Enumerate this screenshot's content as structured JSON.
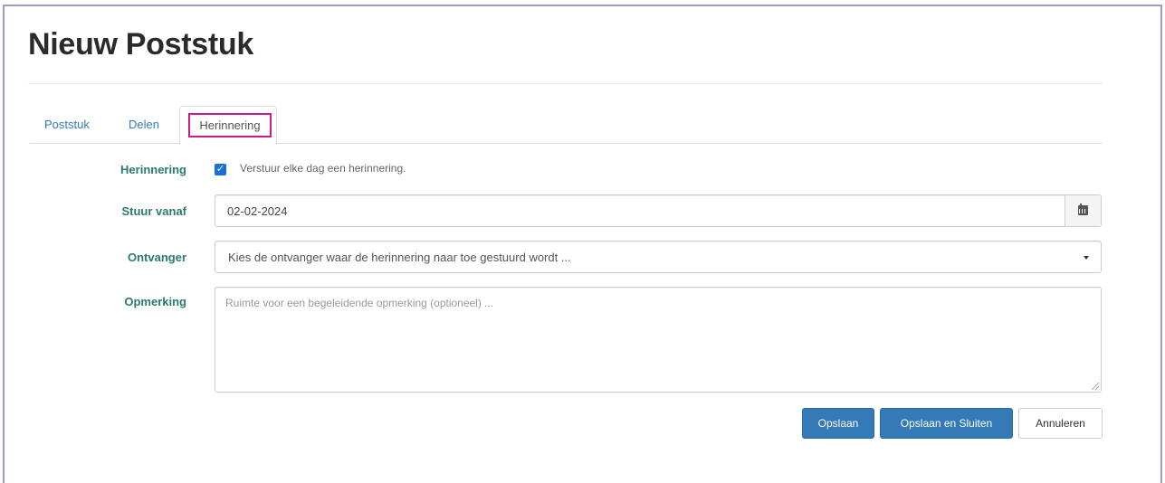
{
  "page": {
    "title": "Nieuw Poststuk"
  },
  "tabs": [
    {
      "label": "Poststuk"
    },
    {
      "label": "Delen"
    },
    {
      "label": "Herinnering",
      "active": true
    }
  ],
  "form": {
    "reminder": {
      "label": "Herinnering",
      "checkbox_checked": true,
      "checkbox_label": "Verstuur elke dag een herinnering."
    },
    "send_from": {
      "label": "Stuur vanaf",
      "value": "02-02-2024",
      "icon": "calendar-icon"
    },
    "recipient": {
      "label": "Ontvanger",
      "placeholder": "Kies de ontvanger waar de herinnering naar toe gestuurd wordt ..."
    },
    "remark": {
      "label": "Opmerking",
      "placeholder": "Ruimte voor een begeleidende opmerking (optioneel) ..."
    }
  },
  "buttons": {
    "save": "Opslaan",
    "save_close": "Opslaan en Sluiten",
    "cancel": "Annuleren"
  },
  "colors": {
    "accent": "#337ab7",
    "label": "#2a7a70",
    "highlight": "#cc1a8a",
    "frame": "#9d9ccc"
  }
}
